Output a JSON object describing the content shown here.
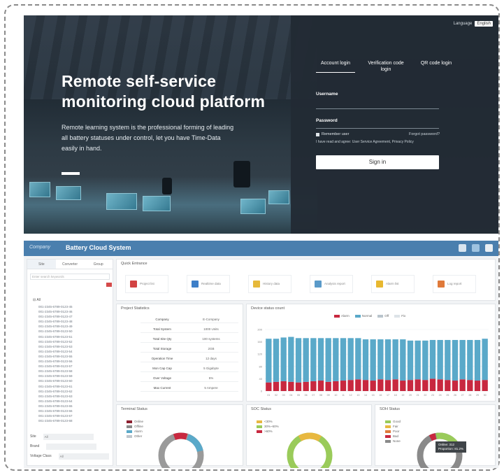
{
  "login": {
    "hero_title_line1": "Remote self-service",
    "hero_title_line2": "monitoring cloud platform",
    "hero_desc": "Remote learning system is the professional forming of leading all battery statuses under control, let you have Time-Data easily in hand.",
    "language_label": "Language",
    "language_value": "English",
    "tabs": [
      "Account login",
      "Verification code login",
      "QR code login"
    ],
    "username_label": "Username",
    "password_label": "Password",
    "remember_label": "Remember user",
    "forgot_label": "Forgot password?",
    "agree_text": "I have read and agree: User Service Agreement, Privacy Policy",
    "signin_label": "Sign in"
  },
  "dashboard": {
    "logo_text": "Company",
    "title": "Battery Cloud System",
    "sidebar": {
      "tabs": [
        "Site",
        "Converter",
        "Group"
      ],
      "search_placeholder": "Enter search keywords",
      "root_label": "All",
      "items": [
        "001-2345-6789-0123-45",
        "001-2345-6789-0123-46",
        "001-2345-6789-0123-47",
        "001-2345-6789-0123-48",
        "001-2345-6789-0123-49",
        "001-2345-6789-0123-50",
        "001-2345-6789-0123-51",
        "001-2345-6789-0123-52",
        "001-2345-6789-0123-53",
        "001-2345-6789-0123-54",
        "001-2345-6789-0123-55",
        "001-2345-6789-0123-56",
        "001-2345-6789-0123-57",
        "001-2345-6789-0123-58",
        "001-2345-6789-0123-59",
        "001-2345-6789-0123-60",
        "001-2345-6789-0123-61",
        "001-2345-6789-0123-62",
        "001-2345-6789-0123-63",
        "001-2345-6789-0123-64",
        "001-2345-6789-0123-65",
        "001-2345-6789-0123-66",
        "001-2345-6789-0123-67",
        "001-2345-6789-0123-68"
      ],
      "form": [
        {
          "label": "Site",
          "value": "All"
        },
        {
          "label": "Brand",
          "value": ""
        },
        {
          "label": "Voltage Class",
          "value": "All"
        }
      ]
    },
    "quick_panel_title": "Quick Entrance",
    "quick_items": [
      {
        "icon": "folder-icon",
        "label": "Project list",
        "color": "#d24343"
      },
      {
        "icon": "list-icon",
        "label": "Realtime data",
        "color": "#3d7fc8"
      },
      {
        "icon": "folder-open-icon",
        "label": "History data",
        "color": "#e6b93a"
      },
      {
        "icon": "tag-icon",
        "label": "Analysis report",
        "color": "#5a9ac9"
      },
      {
        "icon": "star-icon",
        "label": "Alarm list",
        "color": "#e8b830"
      },
      {
        "icon": "doc-icon",
        "label": "Log report",
        "color": "#e07a3a"
      }
    ],
    "info_panel_title": "Project Statistics",
    "info_rows": [
      {
        "k": "Company",
        "v": "E-Company"
      },
      {
        "k": "Total System",
        "v": "1000 Units"
      },
      {
        "k": "Total Site Qty",
        "v": "100 systems"
      },
      {
        "k": "Total Storage",
        "v": "2GB"
      },
      {
        "k": "Operation Time",
        "v": "12 days"
      },
      {
        "k": "Mon Cap Cap",
        "v": "5 Gigabyte"
      },
      {
        "k": "Over Voltage",
        "v": "5%"
      },
      {
        "k": "Max Current",
        "v": "5 Ampere"
      }
    ],
    "alarm_panel_title": "Device status count",
    "alarm_legend": [
      "Alarm",
      "Normal",
      "Off",
      "Fix"
    ],
    "donut1_title": "Terminal Status",
    "donut1_legend": [
      "Online",
      "Offline",
      "Alarm",
      "Other"
    ],
    "donut2_title": "SOC Status",
    "donut2_legend": [
      "<30%",
      "30%~60%",
      ">60%"
    ],
    "donut3_title": "SOH Status",
    "donut3_legend": [
      "Good",
      "Fair",
      "Poor",
      "Bad",
      "None"
    ],
    "tooltip_line1": "Online: 312",
    "tooltip_line2": "Proportion: 81.2%",
    "colors": {
      "alarm": "#c8283f",
      "normal": "#5aa9c9",
      "header": "#4a7fae"
    }
  },
  "chart_data": {
    "type": "bar",
    "stacked": true,
    "categories": [
      "01",
      "02",
      "03",
      "04",
      "05",
      "06",
      "07",
      "08",
      "09",
      "10",
      "11",
      "12",
      "13",
      "14",
      "15",
      "16",
      "17",
      "18",
      "19",
      "20",
      "21",
      "22",
      "23",
      "24",
      "25",
      "26",
      "27",
      "28",
      "29",
      "30"
    ],
    "ylim": [
      0,
      200
    ],
    "yticks": [
      0,
      40,
      80,
      120,
      160,
      200
    ],
    "series": [
      {
        "name": "Alarm",
        "values": [
          28,
          30,
          32,
          30,
          28,
          30,
          32,
          34,
          30,
          32,
          34,
          36,
          38,
          36,
          34,
          38,
          36,
          38,
          34,
          36,
          38,
          36,
          40,
          38,
          36,
          34,
          38,
          36,
          34,
          36
        ]
      },
      {
        "name": "Normal",
        "values": [
          142,
          140,
          142,
          146,
          144,
          142,
          140,
          138,
          142,
          140,
          138,
          136,
          134,
          132,
          134,
          130,
          132,
          130,
          134,
          128,
          126,
          128,
          126,
          128,
          130,
          132,
          128,
          130,
          132,
          134
        ]
      }
    ]
  }
}
